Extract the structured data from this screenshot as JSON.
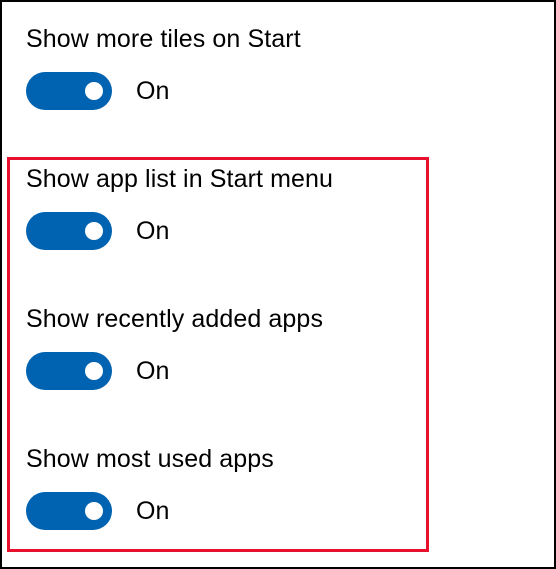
{
  "colors": {
    "toggle_on": "#0063b1",
    "knob": "#ffffff",
    "highlight": "#e8112d",
    "text": "#000000"
  },
  "settings": [
    {
      "label": "Show more tiles on Start",
      "state": "On",
      "enabled": true
    },
    {
      "label": "Show app list in Start menu",
      "state": "On",
      "enabled": true
    },
    {
      "label": "Show recently added apps",
      "state": "On",
      "enabled": true
    },
    {
      "label": "Show most used apps",
      "state": "On",
      "enabled": true
    }
  ]
}
